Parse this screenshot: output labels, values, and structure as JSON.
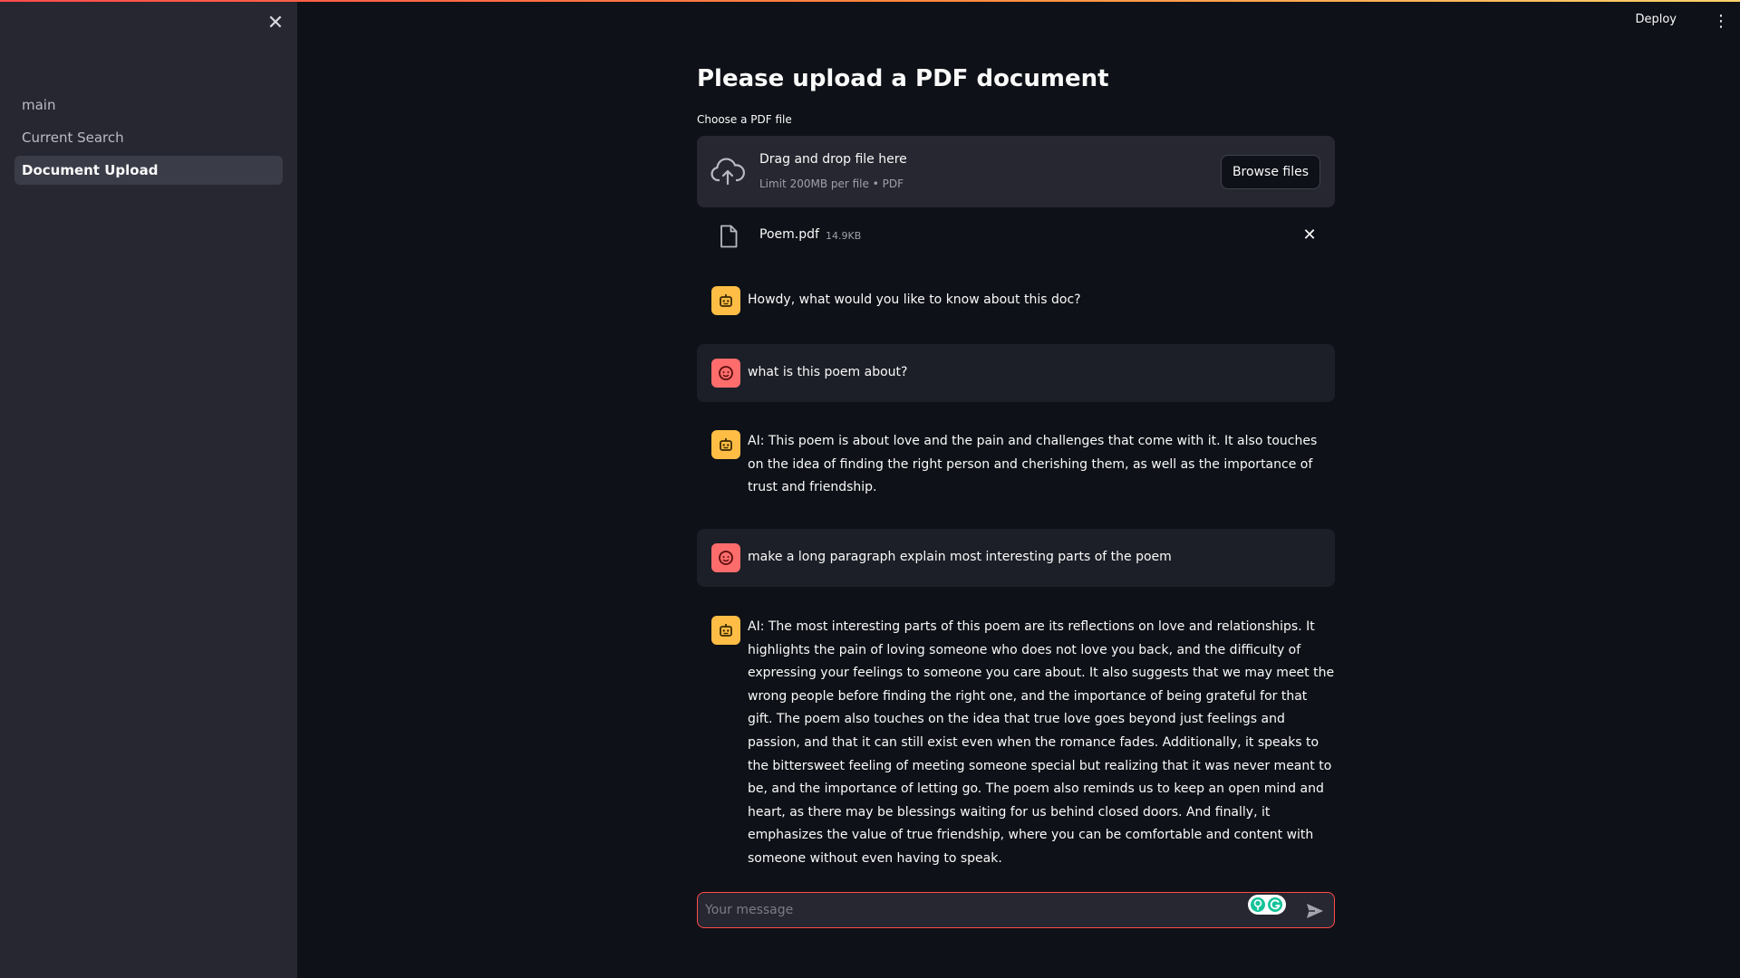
{
  "app": {
    "accent_color": "#ff4b4b",
    "background_color": "#0e1117",
    "sidebar_color": "#262730"
  },
  "sidebar": {
    "close_icon": "close-icon",
    "nav_items": [
      {
        "label": "main",
        "active": false
      },
      {
        "label": "Current Search",
        "active": false
      },
      {
        "label": "Document Upload",
        "active": true
      }
    ]
  },
  "header": {
    "deploy_label": "Deploy",
    "menu_icon": "vertical-dots-icon"
  },
  "page": {
    "title": "Please upload a PDF document",
    "uploader_label": "Choose a PDF file"
  },
  "uploader": {
    "dropzone_title": "Drag and drop file here",
    "dropzone_subtitle": "Limit 200MB per file • PDF",
    "browse_label": "Browse files",
    "icon": "cloud-upload-icon"
  },
  "uploaded_file": {
    "name": "Poem.pdf",
    "size": "14.9KB",
    "icon": "file-icon",
    "remove_icon": "close-icon"
  },
  "messages": [
    {
      "role": "assistant",
      "avatar_icon": "robot-icon",
      "text": "Howdy, what would you like to know about this doc?"
    },
    {
      "role": "user",
      "avatar_icon": "smiley-face-icon",
      "text": "what is this poem about?"
    },
    {
      "role": "assistant",
      "avatar_icon": "robot-icon",
      "text": "AI: This poem is about love and the pain and challenges that come with it. It also touches on the idea of finding the right person and cherishing them, as well as the importance of trust and friendship."
    },
    {
      "role": "user",
      "avatar_icon": "smiley-face-icon",
      "text": "make a long paragraph explain most interesting parts of the poem"
    },
    {
      "role": "assistant",
      "avatar_icon": "robot-icon",
      "text": "AI: The most interesting parts of this poem are its reflections on love and relationships. It highlights the pain of loving someone who does not love you back, and the difficulty of expressing your feelings to someone you care about. It also suggests that we may meet the wrong people before finding the right one, and the importance of being grateful for that gift. The poem also touches on the idea that true love goes beyond just feelings and passion, and that it can still exist even when the romance fades. Additionally, it speaks to the bittersweet feeling of meeting someone special but realizing that it was never meant to be, and the importance of letting go. The poem also reminds us to keep an open mind and heart, as there may be blessings waiting for us behind closed doors. And finally, it emphasizes the value of true friendship, where you can be comfortable and content with someone without even having to speak."
    }
  ],
  "chat_input": {
    "placeholder": "Your message",
    "value": "",
    "send_icon": "send-icon",
    "extension_icon": "grammarly-icon"
  }
}
